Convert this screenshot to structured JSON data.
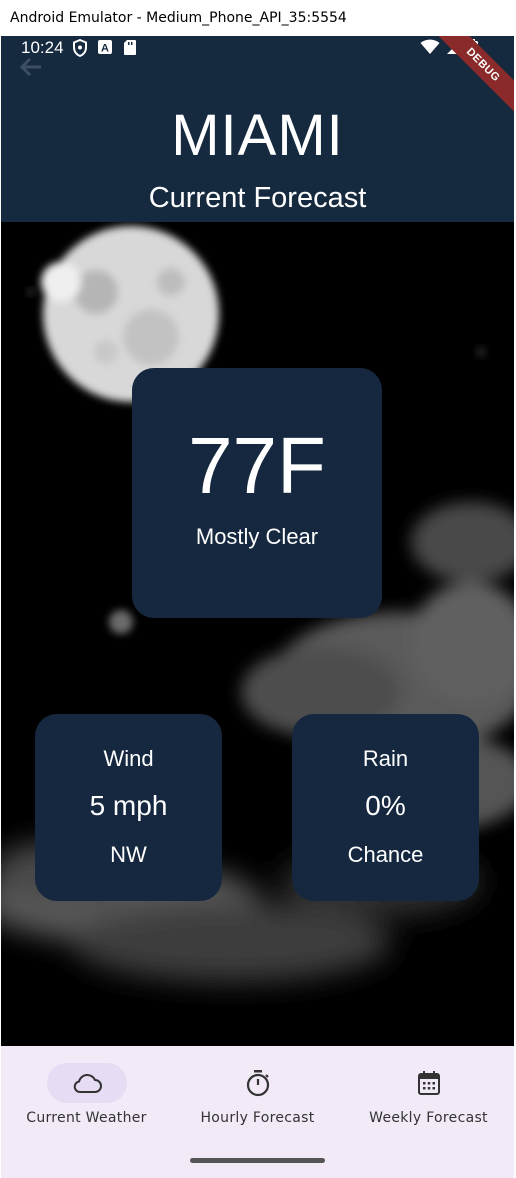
{
  "window": {
    "title": "Android Emulator - Medium_Phone_API_35:5554"
  },
  "status_bar": {
    "time": "10:24",
    "left_icons": [
      "shield-icon",
      "a-icon",
      "sd-card-icon"
    ],
    "right_icons": [
      "wifi-icon",
      "signal-icon",
      "battery-icon"
    ]
  },
  "debug_banner": "DEBUG",
  "app_bar": {
    "city": "MIAMI",
    "subtitle": "Current Forecast",
    "back_icon": "arrow-back-icon"
  },
  "current": {
    "temperature": "77F",
    "condition": "Mostly Clear"
  },
  "wind": {
    "label": "Wind",
    "value": "5 mph",
    "direction": "NW"
  },
  "rain": {
    "label": "Rain",
    "value": "0%",
    "sub": "Chance"
  },
  "bottom_nav": {
    "items": [
      {
        "label": "Current Weather",
        "icon": "cloud-icon",
        "active": true
      },
      {
        "label": "Hourly Forecast",
        "icon": "timer-icon",
        "active": false
      },
      {
        "label": "Weekly Forecast",
        "icon": "calendar-icon",
        "active": false
      }
    ]
  },
  "colors": {
    "app_bar": "#162a3f",
    "card": "#15283f",
    "nav_bg": "#f2ebf7",
    "nav_active_pill": "#e6dcf3"
  }
}
